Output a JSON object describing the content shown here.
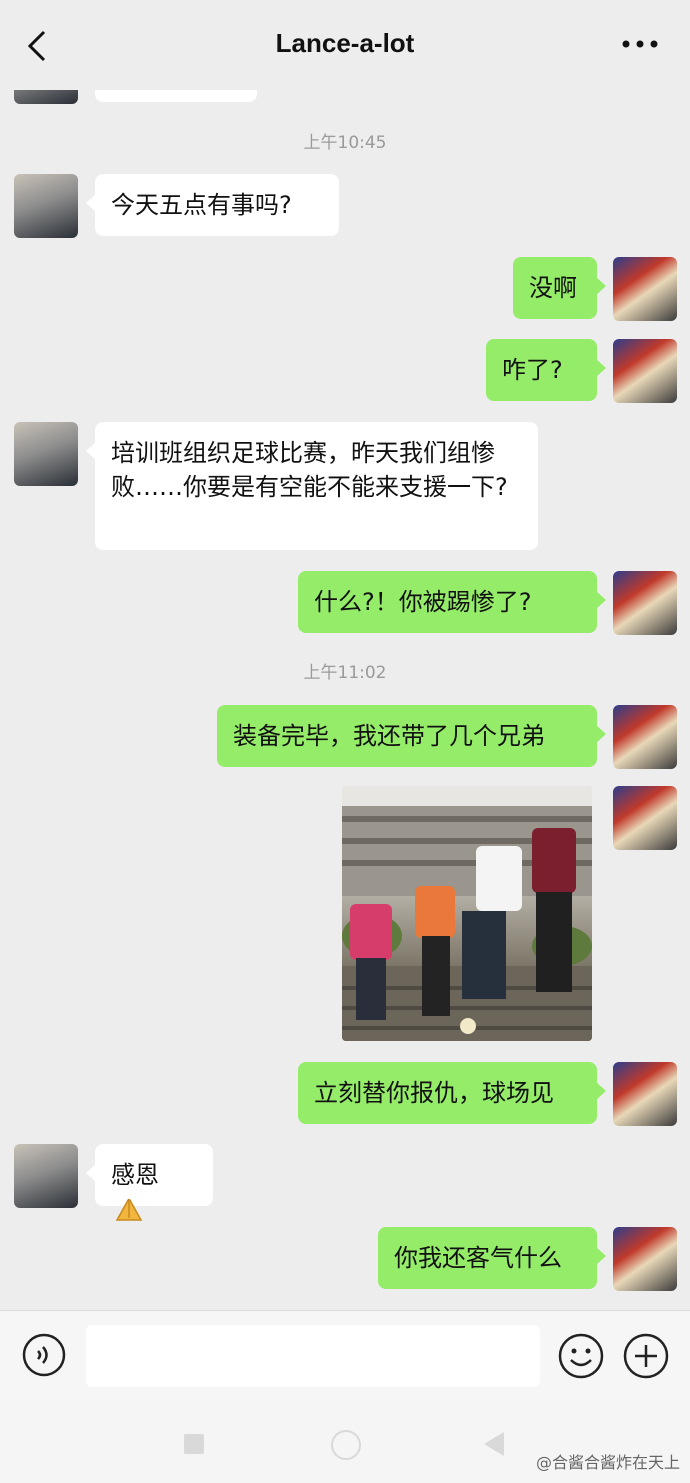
{
  "header": {
    "title": "Lance-a-lot"
  },
  "timestamps": [
    "上午10:45",
    "上午11:02"
  ],
  "messages": {
    "m1": "今天五点有事吗?",
    "m2": "没啊",
    "m3": "咋了?",
    "m4": "培训班组织足球比赛，昨天我们组惨败……你要是有空能不能来支援一下?",
    "m5": "什么?！你被踢惨了?",
    "m6": "装备完毕，我还带了几个兄弟",
    "m8": "立刻替你报仇，球场见",
    "m9": "感恩",
    "m10": "你我还客气什么"
  },
  "watermark": {
    "weibo": "@合酱合酱炸在天上"
  }
}
